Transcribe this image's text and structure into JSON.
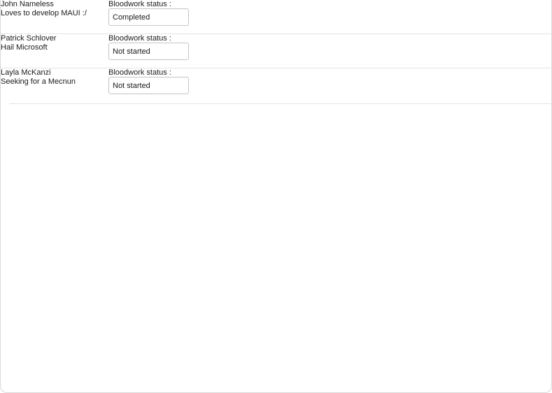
{
  "patients": [
    {
      "name": "John Nameless",
      "description": "Loves to develop MAUI :/",
      "status_label": "Bloodwork status :",
      "status_value": "Completed"
    },
    {
      "name": "Patrick Schlover",
      "description": "Hail Microsoft",
      "status_label": "Bloodwork status :",
      "status_value": "Not started"
    },
    {
      "name": "Layla McKanzi",
      "description": "Seeking for a Mecnun",
      "status_label": "Bloodwork status :",
      "status_value": "Not started"
    }
  ]
}
